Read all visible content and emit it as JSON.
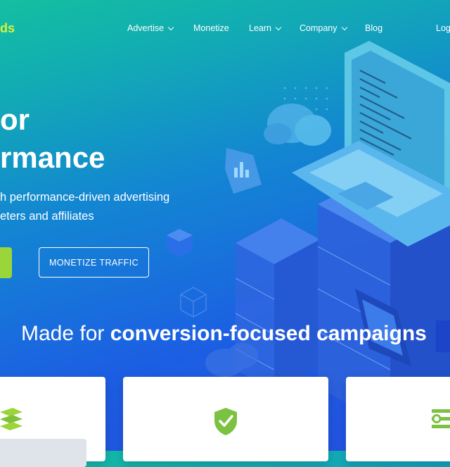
{
  "brand": {
    "logo_text": "ds"
  },
  "nav": {
    "items": [
      {
        "label": "Advertise",
        "has_dropdown": true
      },
      {
        "label": "Monetize",
        "has_dropdown": false
      },
      {
        "label": "Learn",
        "has_dropdown": true
      },
      {
        "label": "Company",
        "has_dropdown": true
      },
      {
        "label": "Blog",
        "has_dropdown": false
      },
      {
        "label": "Log",
        "has_dropdown": false
      }
    ]
  },
  "hero": {
    "title_line1": "or",
    "title_line2": "rmance",
    "subtitle_line1": "h performance-driven advertising",
    "subtitle_line2": "eters and affiliates",
    "monetize_button": "MONETIZE TRAFFIC"
  },
  "section": {
    "title_prefix": "Made for ",
    "title_bold": "conversion-focused campaigns"
  },
  "colors": {
    "accent_green": "#9ad53a",
    "logo_yellow": "#d6f23a",
    "card_white": "#ffffff"
  },
  "icons": {
    "card1": "layers-icon",
    "card2": "shield-check-icon",
    "card3": "sliders-icon"
  }
}
